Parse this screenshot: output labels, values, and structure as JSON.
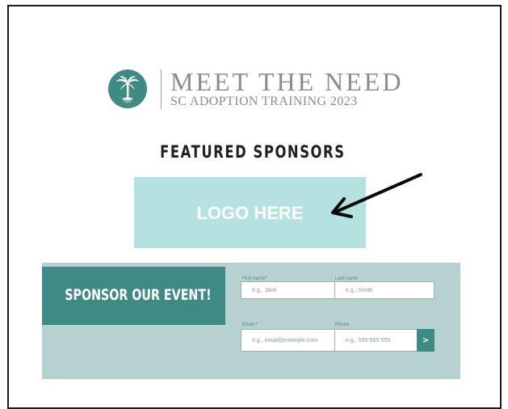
{
  "header": {
    "logo_icon": "palm-tree-icon",
    "title": "MEET THE NEED",
    "subtitle": "SC ADOPTION TRAINING 2023",
    "accent_color": "#3f8a84"
  },
  "featured": {
    "heading": "FEATURED SPONSORS",
    "logo_placeholder": "LOGO HERE",
    "logo_box_color": "#b6e1e1",
    "arrow_icon": "arrow-left-icon"
  },
  "form": {
    "cta": "SPONSOR OUR EVENT!",
    "panel_color": "#b7d1d1",
    "fields": {
      "first_name": {
        "label": "First name*",
        "placeholder": "e.g., Jane"
      },
      "last_name": {
        "label": "Last name",
        "placeholder": "e.g., Smith"
      },
      "email": {
        "label": "Email *",
        "placeholder": "e.g., email@example.com"
      },
      "phone": {
        "label": "Phone",
        "placeholder": "e.g., 555-555-555"
      }
    },
    "submit_label": ">"
  }
}
